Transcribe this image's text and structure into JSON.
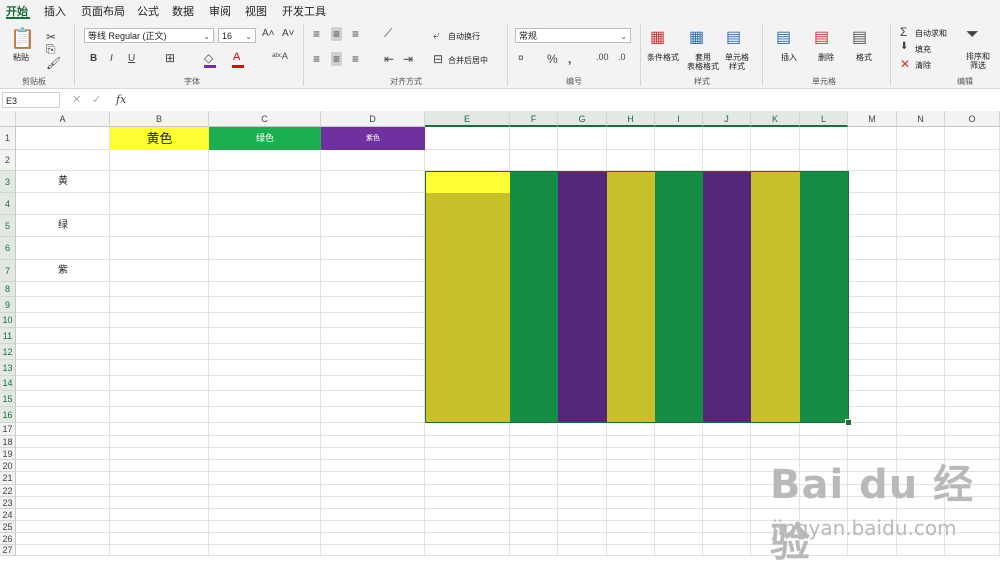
{
  "tabs": [
    "开始",
    "插入",
    "页面布局",
    "公式",
    "数据",
    "审阅",
    "视图",
    "开发工具"
  ],
  "ribbon": {
    "paste_label": "粘贴",
    "clipboard_group": "剪贴板",
    "font_name": "等线 Regular (正文)",
    "font_size": "16",
    "font_group": "字体",
    "bold": "B",
    "italic": "I",
    "underline": "U",
    "wrap_text": "自动换行",
    "merge_center": "合并后居中",
    "align_group": "对齐方式",
    "number_format": "常规",
    "number_group": "编号",
    "cond_format": "条件格式",
    "table_format_l1": "套用",
    "table_format_l2": "表格格式",
    "cell_style_l1": "单元格",
    "cell_style_l2": "样式",
    "styles_group": "样式",
    "insert": "插入",
    "delete": "删除",
    "format": "格式",
    "cells_group": "单元格",
    "autosum": "自动求和",
    "fill": "填充",
    "clear": "清除",
    "sort_filter_l1": "排序和",
    "sort_filter_l2": "筛选",
    "editing_group": "编辑"
  },
  "formula_bar": {
    "name_box": "E3",
    "fx": "fx",
    "formula": ""
  },
  "columns": [
    "A",
    "B",
    "C",
    "D",
    "E",
    "F",
    "G",
    "H",
    "I",
    "J",
    "K",
    "L",
    "M",
    "N",
    "O"
  ],
  "rows": [
    "1",
    "2",
    "3",
    "4",
    "5",
    "6",
    "7",
    "8",
    "9",
    "10",
    "11",
    "12",
    "13",
    "14",
    "15",
    "16",
    "17",
    "18",
    "19",
    "20",
    "21",
    "22",
    "23",
    "24",
    "25",
    "26",
    "27"
  ],
  "cells": {
    "B1": "黄色",
    "C1": "绿色",
    "D1": "紫色",
    "A3": "黄",
    "A5": "绿",
    "A7": "紫"
  },
  "colors": {
    "yellow_header": "#ffff33",
    "green_header": "#1ab050",
    "purple_header": "#7030a0",
    "olive": "#c7c02a",
    "green_fill": "#168c45",
    "purple_fill": "#542879",
    "accent": "#1b6e3a"
  },
  "watermark": {
    "brand": "Bai du 经验",
    "url": "jingyan.baidu.com"
  }
}
